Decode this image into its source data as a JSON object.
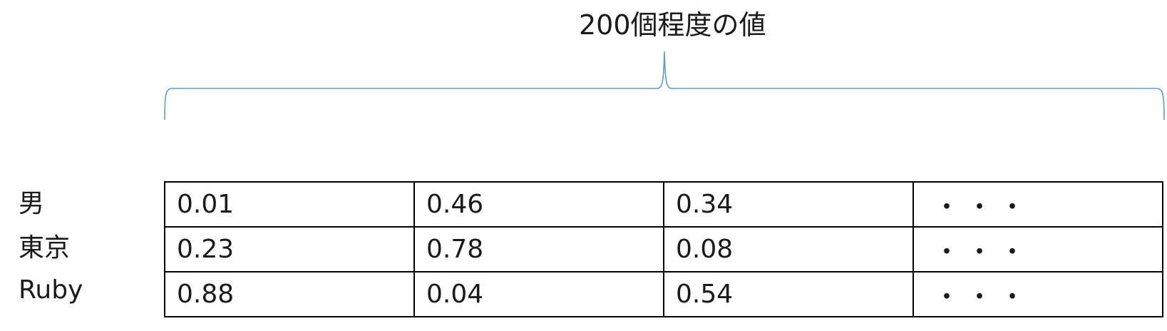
{
  "brace": {
    "label": "200個程度の値",
    "color": "#5b9bd5"
  },
  "rows": [
    {
      "label": "男",
      "cells": [
        "0.01",
        "0.46",
        "0.34",
        "・・・"
      ]
    },
    {
      "label": "東京",
      "cells": [
        "0.23",
        "0.78",
        "0.08",
        "・・・"
      ]
    },
    {
      "label": "Ruby",
      "cells": [
        "0.88",
        "0.04",
        "0.54",
        "・・・"
      ]
    }
  ]
}
